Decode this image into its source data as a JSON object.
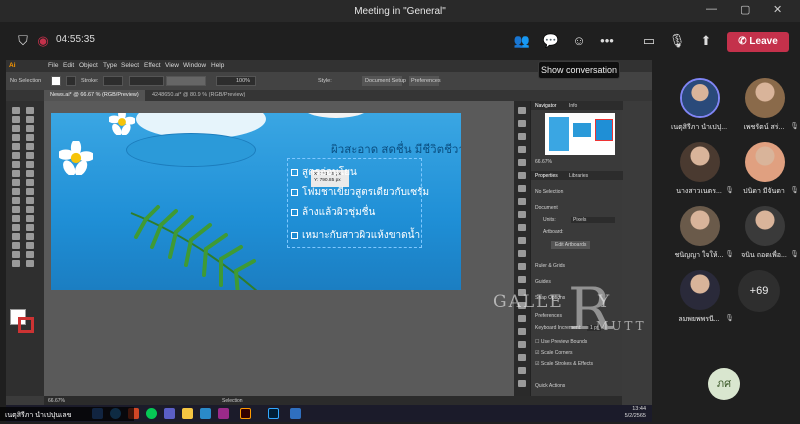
{
  "window": {
    "title": "Meeting in \"General\""
  },
  "meeting": {
    "timer": "04:55:35",
    "leave_label": "Leave",
    "tooltip": "Show conversation"
  },
  "illustrator": {
    "menu": [
      "Ai",
      "File",
      "Edit",
      "Object",
      "Type",
      "Select",
      "Effect",
      "View",
      "Window",
      "Help"
    ],
    "control": {
      "selection": "No Selection",
      "stroke": "Stroke:",
      "opacity": "100%",
      "style": "Style:",
      "doc_setup": "Document Setup",
      "preferences": "Preferences"
    },
    "tabs": [
      "News.ai* @ 66.67 % (RGB/Preview)",
      "4248650.ai* @ 80.9 % (RGB/Preview)"
    ],
    "artboard": {
      "headline": "ผิวสะอาด สดชื่น มีชีวิตชีวา",
      "features": [
        "สูตรอ่อนโยน",
        "โฟมชาเขียวสูตรเดียวกับเซรั่ม",
        "ล้างแล้วผิวชุ่มชื่น",
        "เหมาะกับสาวผิวแห้งขาดน้ำ"
      ],
      "coord_x": "X: 731.15 px",
      "coord_y": "Y: 790.85 px"
    },
    "panel": {
      "nav_tab": "Navigator",
      "info_tab": "Info",
      "zoom": "66.67%",
      "props_tab": "Properties",
      "libraries_tab": "Libraries",
      "no_selection": "No Selection",
      "document": "Document",
      "units_label": "Units:",
      "units_value": "Pixels",
      "artboard_label": "Artboard:",
      "edit_artboards": "Edit Artboards",
      "rulers": "Ruler & Grids",
      "guides": "Guides",
      "snap": "Snap Options",
      "preferences": "Preferences",
      "keyboard": "Keyboard Increment:",
      "keyboard_value": "1 pt",
      "opt1": "Use Preview Bounds",
      "opt2": "Scale Corners",
      "opt3": "Scale Strokes & Effects",
      "quick_actions": "Quick Actions"
    },
    "status": {
      "zoom": "66.67%",
      "tool": "Selection"
    }
  },
  "taskbar": {
    "time": "13:44",
    "date": "5/2/2565"
  },
  "presenter_name": "เนตุสิรีภา นำเปปุนเลข",
  "watermark": {
    "gallery": "GALLE",
    "r": "R",
    "y": "Y",
    "mutt": "MUTT"
  },
  "participants": [
    {
      "name": "เนตุสิรีภา นำเปปุ...",
      "color": "#2a4a7a"
    },
    {
      "name": "เพชรัตน์ สร่...",
      "color": "#8a6a4a"
    },
    {
      "name": "นางสาวเนตร...",
      "color": "#4a3a30"
    },
    {
      "name": "ปนิดา มีจันดา",
      "color": "#e0a080"
    },
    {
      "name": "ชนิญญา ใจให้...",
      "color": "#6a5a4a"
    },
    {
      "name": "จนิน ถอดเพื่อ...",
      "color": "#3a3a3a"
    },
    {
      "name": "ลมพยพพรนี...",
      "color": "#2a2a3a"
    }
  ],
  "more_count": "+69",
  "self_initials": "ภศ"
}
